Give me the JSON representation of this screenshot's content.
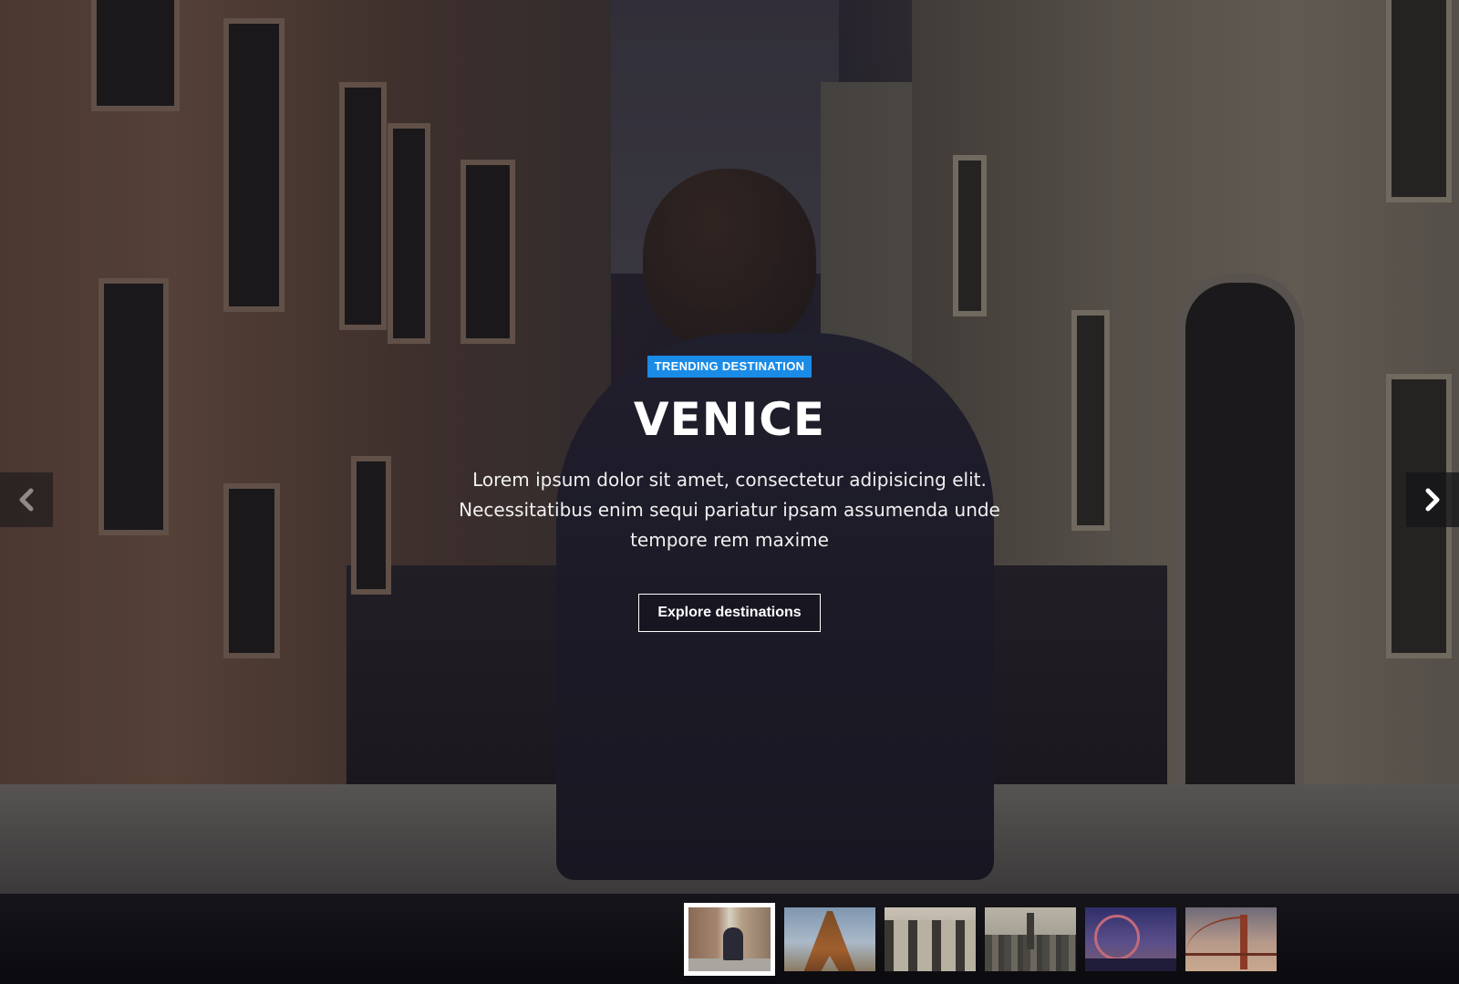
{
  "slide": {
    "badge": "TRENDING DESTINATION",
    "title": "VENICE",
    "description": "Lorem ipsum dolor sit amet, consectetur adipisicing elit. Necessitatibus enim sequi pariatur ipsam assumenda unde tempore rem maxime",
    "cta_label": "Explore destinations"
  },
  "navigation": {
    "prev_icon": "chevron-left-icon",
    "next_icon": "chevron-right-icon"
  },
  "thumbnails": [
    {
      "name": "venice",
      "active": true
    },
    {
      "name": "paris",
      "active": false
    },
    {
      "name": "rome",
      "active": false
    },
    {
      "name": "new-york",
      "active": false
    },
    {
      "name": "london",
      "active": false
    },
    {
      "name": "san-francisco",
      "active": false
    }
  ],
  "colors": {
    "accent": "#1a8be6",
    "thumbbar_bg": "#0e0d12",
    "text": "#ffffff"
  }
}
